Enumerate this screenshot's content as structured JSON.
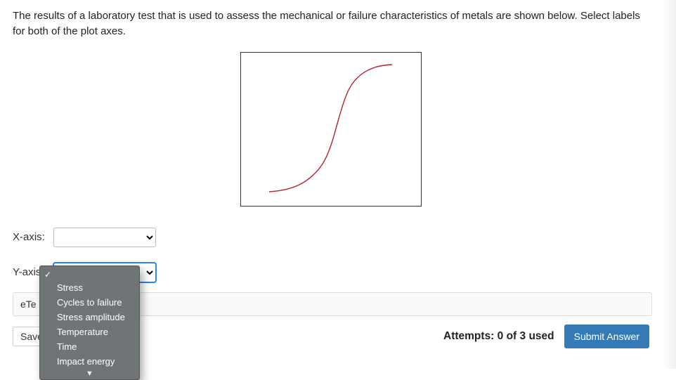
{
  "question": {
    "text": "The results of a laboratory test that is used to assess the mechanical or failure characteristics of metals are shown below. Select labels for both of the plot axes."
  },
  "chart_data": {
    "type": "line",
    "title": "",
    "xlabel": "",
    "ylabel": "",
    "x": [
      0.15,
      0.22,
      0.3,
      0.38,
      0.45,
      0.5,
      0.54,
      0.58,
      0.64,
      0.72,
      0.82
    ],
    "y": [
      0.08,
      0.1,
      0.14,
      0.22,
      0.35,
      0.5,
      0.65,
      0.78,
      0.88,
      0.93,
      0.94
    ],
    "xlim": [
      0,
      1
    ],
    "ylim": [
      0,
      1
    ],
    "legend": false,
    "series_color": "#b5202e"
  },
  "axes": {
    "x": {
      "label": "X-axis:",
      "value": ""
    },
    "y": {
      "label": "Y-axis",
      "value": ""
    }
  },
  "y_dropdown": {
    "blank_selected": true,
    "options": [
      "Stress",
      "Cycles to failure",
      "Stress amplitude",
      "Temperature",
      "Time",
      "Impact energy"
    ],
    "scroll_indicator": "▼"
  },
  "toolbar": {
    "etext_prefix": "eTe",
    "save_prefix": "Save"
  },
  "footer": {
    "attempts_text": "Attempts: 0 of 3 used",
    "submit_label": "Submit Answer"
  }
}
